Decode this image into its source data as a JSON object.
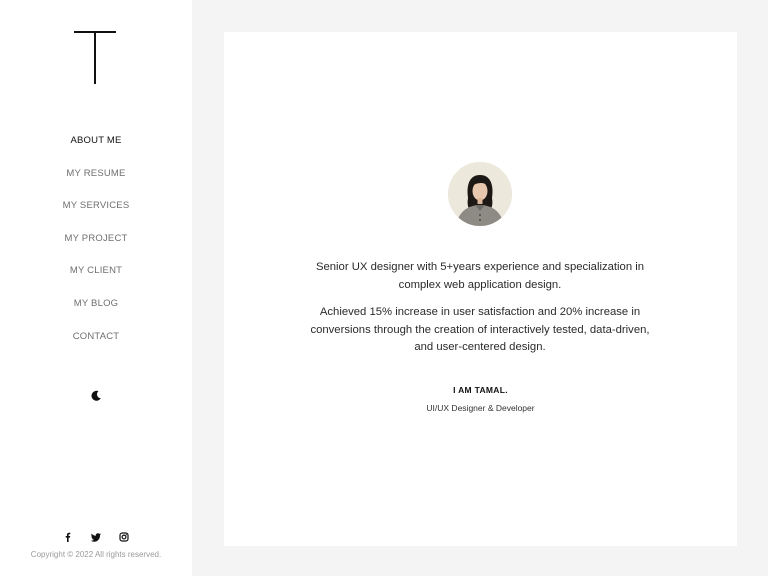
{
  "sidebar": {
    "logo_letter": "T",
    "nav": [
      {
        "label": "ABOUT ME",
        "active": true
      },
      {
        "label": "MY RESUME",
        "active": false
      },
      {
        "label": "MY SERVICES",
        "active": false
      },
      {
        "label": "MY PROJECT",
        "active": false
      },
      {
        "label": "MY CLIENT",
        "active": false
      },
      {
        "label": "MY BLOG",
        "active": false
      },
      {
        "label": "CONTACT",
        "active": false
      }
    ],
    "theme_toggle_icon": "moon-icon",
    "social_icons": [
      "facebook-icon",
      "twitter-icon",
      "instagram-icon"
    ],
    "copyright": "Copyright © 2022 All rights reserved."
  },
  "profile": {
    "avatar_icon": "profile-photo",
    "bio": [
      "Senior UX designer with 5+years experience and specialization in complex web application design.",
      "Achieved 15% increase in user satisfaction and 20% increase in conversions through the creation of interactively tested, data-driven, and user-centered design."
    ],
    "name": "I AM TAMAL.",
    "role": "UI/UX Designer & Developer"
  },
  "colors": {
    "page_bg": "#f4f4f4",
    "panel_bg": "#ffffff",
    "text": "#1a1a1a",
    "muted": "#6f6f6f"
  }
}
